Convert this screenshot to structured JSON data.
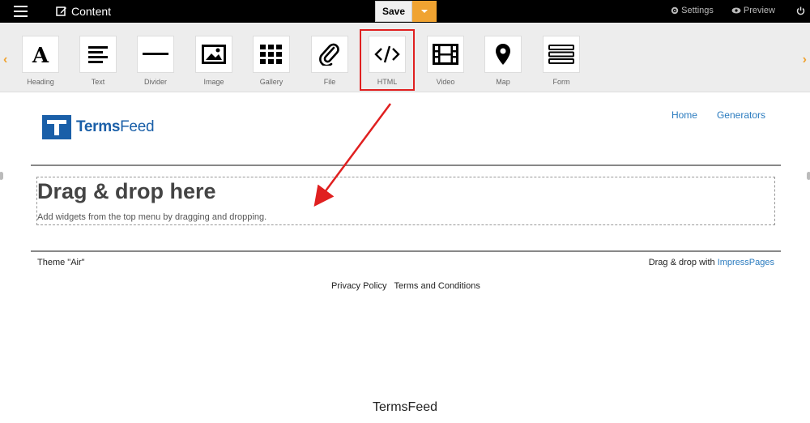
{
  "topbar": {
    "content_label": "Content",
    "save_label": "Save",
    "settings_label": "Settings",
    "preview_label": "Preview"
  },
  "toolbar": {
    "widgets": [
      {
        "label": "Heading",
        "icon": "heading-icon"
      },
      {
        "label": "Text",
        "icon": "text-icon"
      },
      {
        "label": "Divider",
        "icon": "divider-icon"
      },
      {
        "label": "Image",
        "icon": "image-icon"
      },
      {
        "label": "Gallery",
        "icon": "gallery-icon"
      },
      {
        "label": "File",
        "icon": "paperclip-icon"
      },
      {
        "label": "HTML",
        "icon": "code-icon"
      },
      {
        "label": "Video",
        "icon": "film-icon"
      },
      {
        "label": "Map",
        "icon": "map-pin-icon"
      },
      {
        "label": "Form",
        "icon": "form-icon"
      }
    ],
    "highlighted_widget": "HTML",
    "highlight_color": "#e02020",
    "accent_color": "#f0a331"
  },
  "page": {
    "logo": {
      "terms": "Terms",
      "feed": "Feed"
    },
    "nav": [
      "Home",
      "Generators"
    ],
    "dropzone": {
      "title": "Drag & drop here",
      "subtitle": "Add widgets from the top menu by dragging and dropping."
    },
    "footer": {
      "theme": "Theme \"Air\"",
      "powered_prefix": "Drag & drop with ",
      "powered_link": "ImpressPages",
      "links": [
        "Privacy Policy",
        "Terms and Conditions"
      ]
    },
    "link_color": "#2a7bbf"
  },
  "watermark": "TermsFeed"
}
